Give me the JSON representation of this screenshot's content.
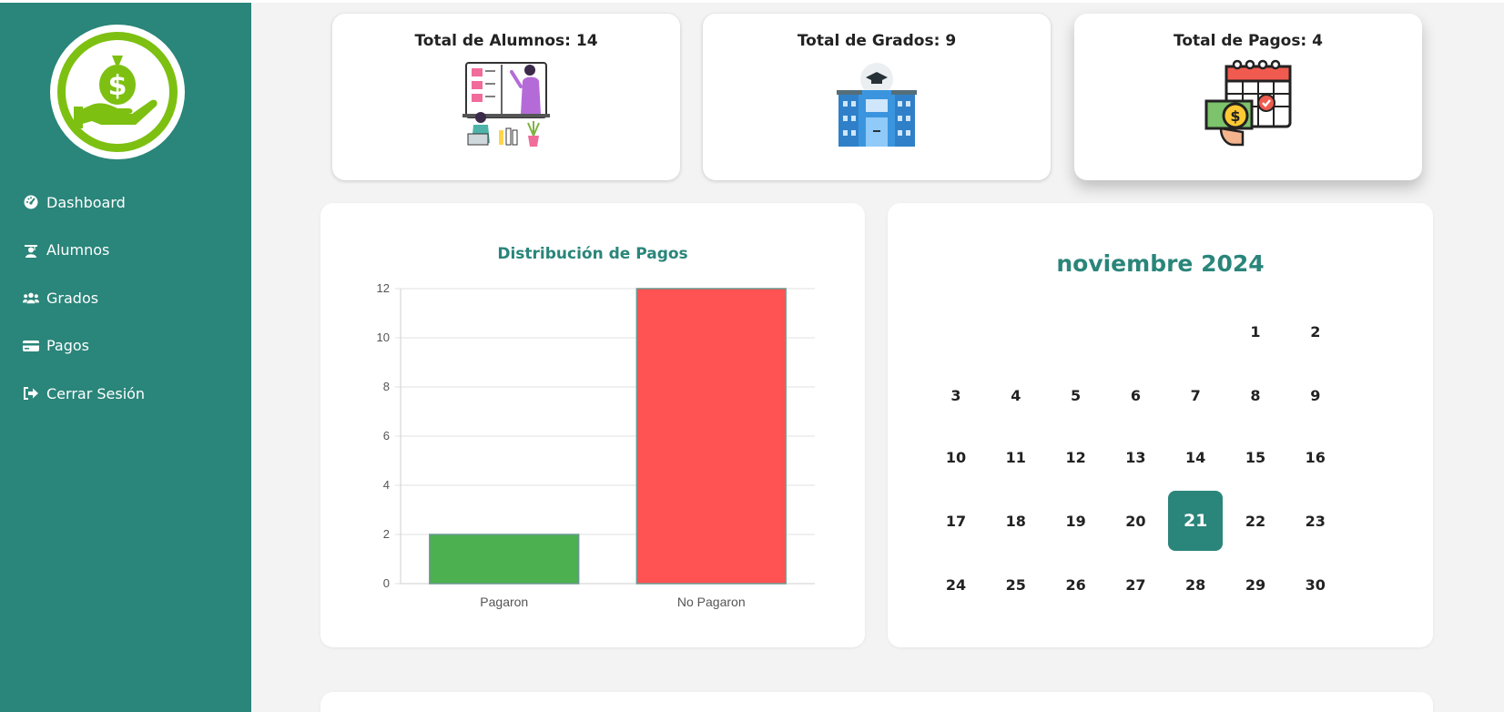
{
  "sidebar": {
    "logo_icon": "money-bag-hand-icon",
    "items": [
      {
        "label": "Dashboard",
        "icon": "dashboard-gauge-icon"
      },
      {
        "label": "Alumnos",
        "icon": "student-icon"
      },
      {
        "label": "Grados",
        "icon": "users-group-icon"
      },
      {
        "label": "Pagos",
        "icon": "credit-card-icon"
      },
      {
        "label": "Cerrar Sesión",
        "icon": "sign-out-icon"
      }
    ]
  },
  "stats": [
    {
      "title": "Total de Alumnos: 14",
      "icon": "online-class-illustration-icon"
    },
    {
      "title": "Total de Grados: 9",
      "icon": "school-building-icon"
    },
    {
      "title": "Total de Pagos: 4",
      "icon": "calendar-payment-icon"
    }
  ],
  "chart_data": {
    "type": "bar",
    "title": "Distribución de Pagos",
    "categories": [
      "Pagaron",
      "No Pagaron"
    ],
    "values": [
      2,
      12
    ],
    "colors": [
      "#4caf50",
      "#ff5252"
    ],
    "ylim": [
      0,
      12
    ],
    "yticks": [
      0,
      2,
      4,
      6,
      8,
      10,
      12
    ],
    "grid": true
  },
  "calendar": {
    "title": "noviembre 2024",
    "first_weekday_index": 5,
    "days": [
      1,
      2,
      3,
      4,
      5,
      6,
      7,
      8,
      9,
      10,
      11,
      12,
      13,
      14,
      15,
      16,
      17,
      18,
      19,
      20,
      21,
      22,
      23,
      24,
      25,
      26,
      27,
      28,
      29,
      30
    ],
    "today": 21
  },
  "colors": {
    "brand": "#2a857a",
    "logo_green": "#7dc012",
    "bar_paid": "#4caf50",
    "bar_unpaid": "#ff5252"
  }
}
